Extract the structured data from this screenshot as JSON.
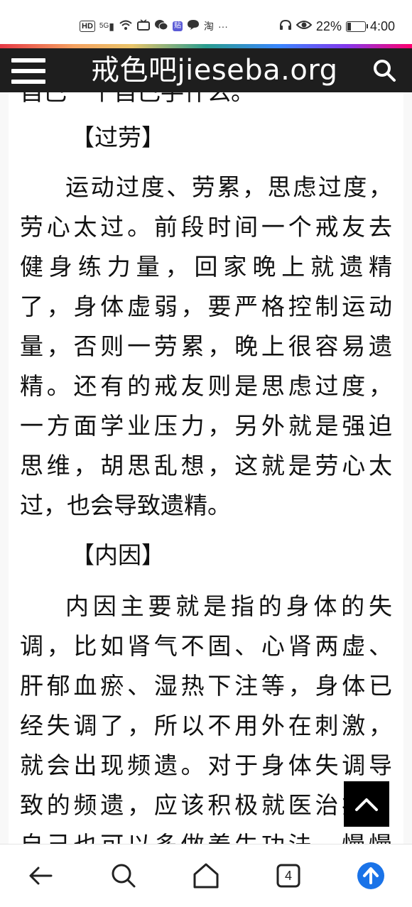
{
  "status_bar": {
    "hd": "HD",
    "signal": "5G",
    "tie_badge": "贴",
    "taobao": "淘",
    "more": "···",
    "battery_percent": "22%",
    "battery_level": 0.22,
    "time": "4:00"
  },
  "header": {
    "title": "戒色吧jieseba.org"
  },
  "article": {
    "lines": [
      "自己一个自己手什么。",
      "【过劳】",
      "运动过度、劳累，思虑过度，",
      "劳心太过。前段时间一个戒友去",
      "健身练力量，回家晚上就遗精",
      "了，身体虚弱，要严格控制运动",
      "量，否则一劳累，晚上很容易遗",
      "精。还有的戒友则是思虑过度，",
      "一方面学业压力，另外就是强迫",
      "思维，胡思乱想，这就是劳心太",
      "过，也会导致遗精。",
      "【内因】",
      "内因主要就是指的身体的失",
      "调，比如肾气不固、心肾两虚、",
      "肝郁血瘀、湿热下注等，身体已",
      "经失调了，所以不用外在刺激，",
      "就会出现频遗。对于身体失调导",
      "致的频遗，应该积极就医治疗，",
      "自己也可以多做养生功法，慢慢"
    ]
  },
  "bottom_nav": {
    "tab_count": "4"
  },
  "colors": {
    "header_bg": "#1e1e1e",
    "accent_blue": "#1a73e8",
    "text": "#111111"
  }
}
